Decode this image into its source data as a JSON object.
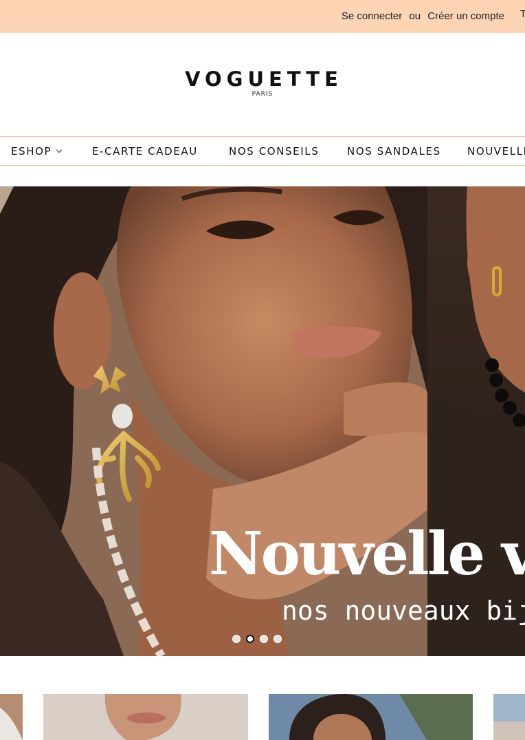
{
  "topbar": {
    "login": "Se connecter",
    "or": "ou",
    "register": "Créer un compte",
    "edge_glyph": "T"
  },
  "brand": {
    "name": "VOGUETTE",
    "city": "PARIS"
  },
  "nav": {
    "items": [
      {
        "label": "ESHOP"
      },
      {
        "label": "E-CARTE CADEAU"
      },
      {
        "label": "NOS CONSEILS"
      },
      {
        "label": "NOS SANDALES"
      },
      {
        "label": "NOUVELLE"
      }
    ]
  },
  "hero": {
    "title": "Nouvelle va",
    "subtitle": "nos nouveaux bij",
    "slides_count": 4,
    "active_slide": 2
  },
  "colors": {
    "topbar_bg": "#fdd5b5",
    "nav_border": "#f2c1a6",
    "text": "#111111"
  },
  "icons": {
    "eshop_dropdown": "chevron-down-icon"
  }
}
